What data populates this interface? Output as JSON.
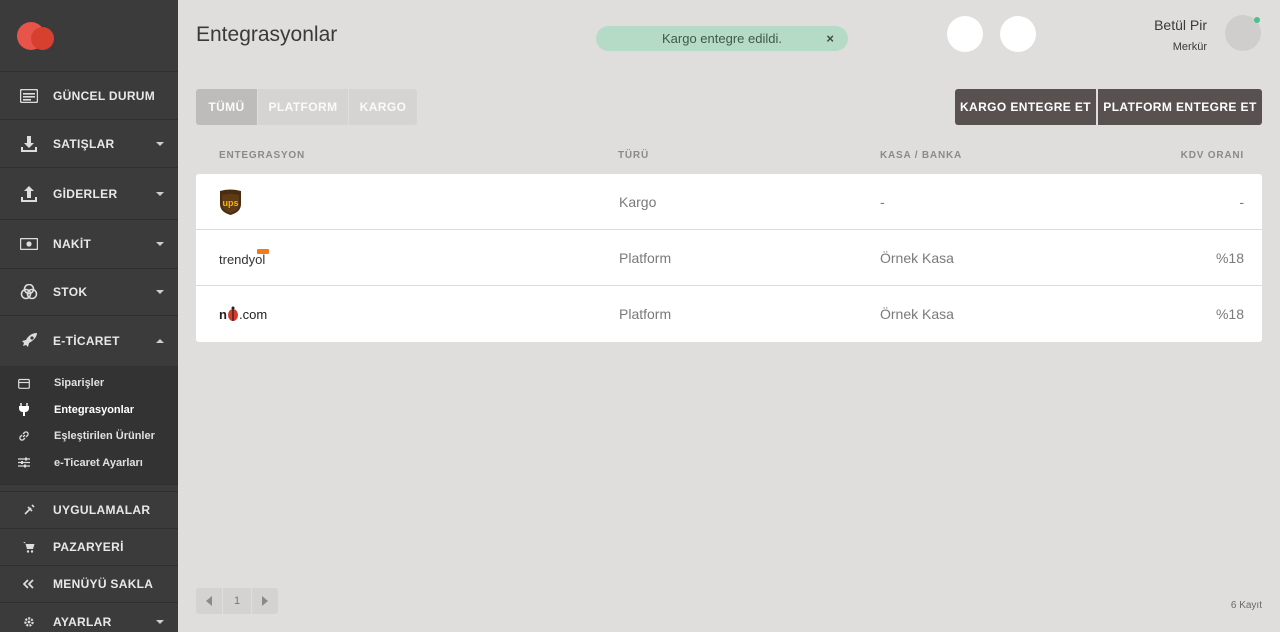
{
  "sidebar": {
    "items": [
      {
        "label": "GÜNCEL DURUM",
        "icon": "dashboard-icon"
      },
      {
        "label": "SATIŞLAR",
        "icon": "download-icon"
      },
      {
        "label": "GİDERLER",
        "icon": "upload-icon"
      },
      {
        "label": "NAKİT",
        "icon": "cash-icon"
      },
      {
        "label": "STOK",
        "icon": "boxes-icon"
      },
      {
        "label": "E-TİCARET",
        "icon": "rocket-icon"
      }
    ],
    "sub_items": [
      {
        "label": "Siparişler",
        "icon": "bag-icon"
      },
      {
        "label": "Entegrasyonlar",
        "icon": "plug-icon"
      },
      {
        "label": "Eşleştirilen Ürünler",
        "icon": "link-icon"
      },
      {
        "label": "e-Ticaret Ayarları",
        "icon": "sliders-icon"
      }
    ],
    "bottom_items": [
      {
        "label": "UYGULAMALAR",
        "icon": "puzzle-icon"
      },
      {
        "label": "PAZARYERİ",
        "icon": "cart-icon"
      },
      {
        "label": "MENÜYÜ SAKLA",
        "icon": "double-chevron-left-icon"
      },
      {
        "label": "AYARLAR",
        "icon": "gear-icon"
      }
    ]
  },
  "header": {
    "title": "Entegrasyonlar",
    "toast": "Kargo entegre edildi.",
    "toast_close": "×",
    "user_name": "Betül Pir",
    "user_role": "Merkür"
  },
  "tabs": [
    {
      "label": "TÜMÜ"
    },
    {
      "label": "PLATFORM"
    },
    {
      "label": "KARGO"
    }
  ],
  "actions": {
    "kargo": "KARGO ENTEGRE ET",
    "platform": "PLATFORM ENTEGRE ET"
  },
  "table": {
    "headers": [
      "ENTEGRASYON",
      "TÜRÜ",
      "KASA / BANKA",
      "KDV ORANI"
    ],
    "rows": [
      {
        "logo": "ups",
        "type": "Kargo",
        "kasa": "-",
        "kdv": "-"
      },
      {
        "logo": "trendyol",
        "type": "Platform",
        "kasa": "Örnek Kasa",
        "kdv": "%18"
      },
      {
        "logo": "n11.com",
        "type": "Platform",
        "kasa": "Örnek Kasa",
        "kdv": "%18"
      }
    ]
  },
  "pager": {
    "page": "1",
    "count": "6 Kayıt"
  }
}
